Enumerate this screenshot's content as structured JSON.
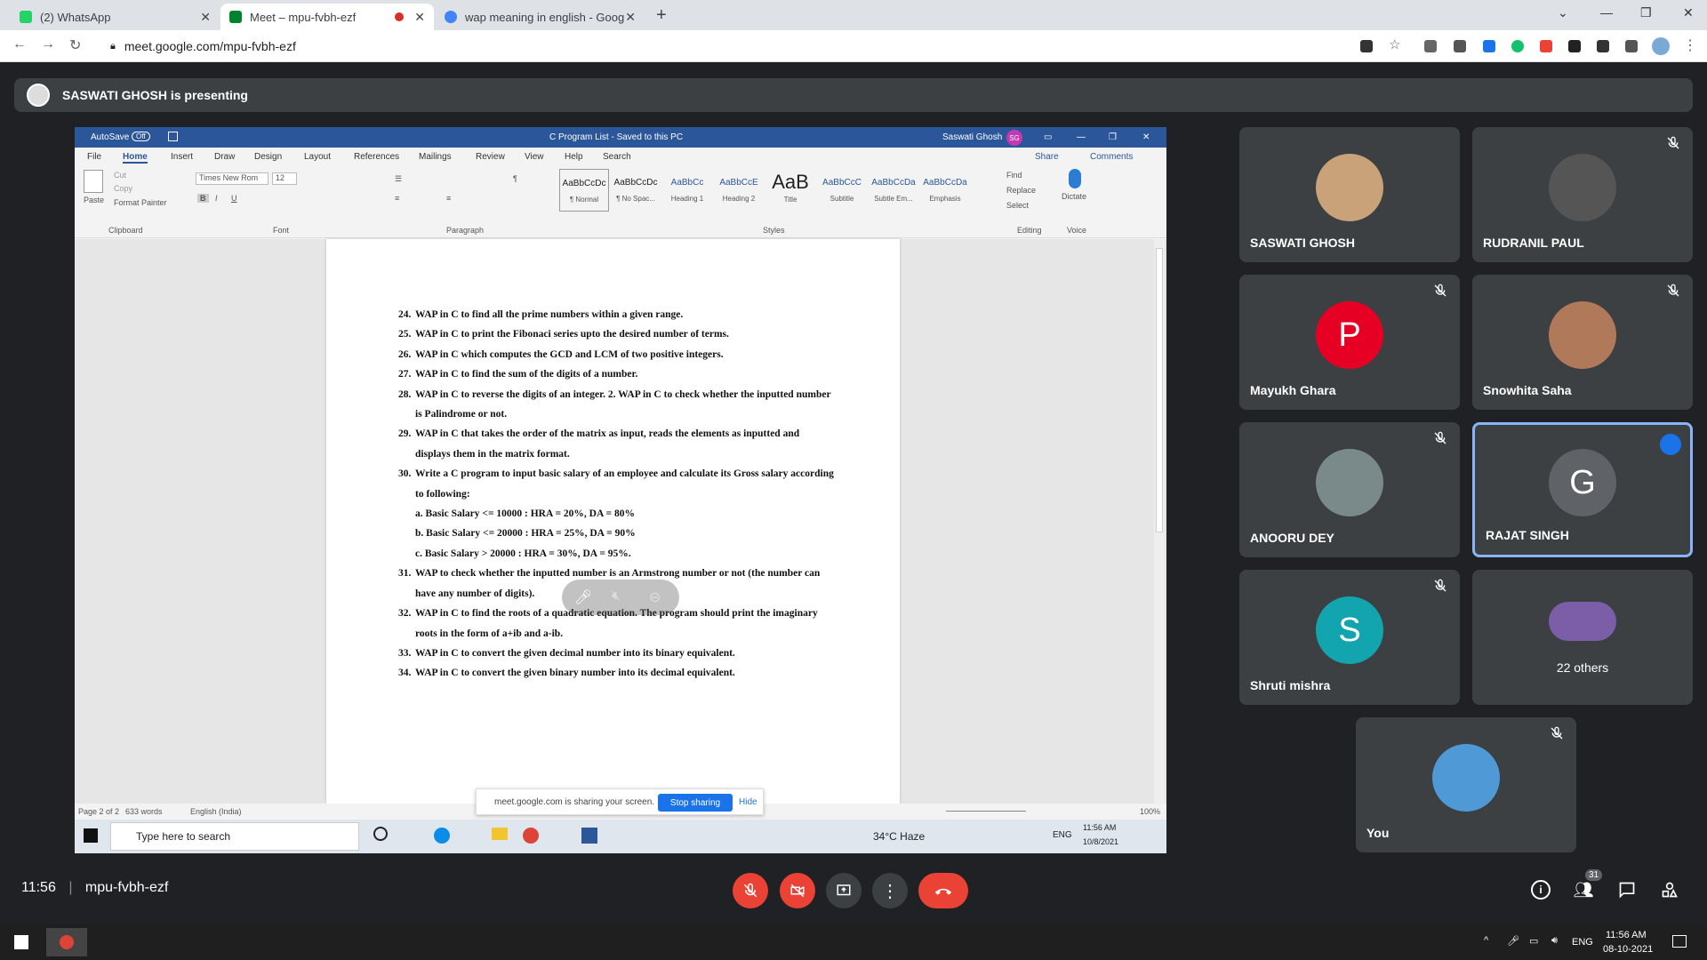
{
  "browser": {
    "tabs": [
      {
        "label": "(2) WhatsApp",
        "color": "#25d366"
      },
      {
        "label": "Meet – mpu-fvbh-ezf",
        "color": "#00832d"
      },
      {
        "label": "wap meaning in english - Google",
        "color": "#4285f4"
      }
    ],
    "url": "meet.google.com/mpu-fvbh-ezf"
  },
  "presenting": {
    "text": "SASWATI GHOSH is presenting"
  },
  "word": {
    "autosave": "AutoSave",
    "autosave_state": "Off",
    "doc_title": "C Program List - Saved to this PC",
    "user": "Saswati Ghosh",
    "user_initials": "SG",
    "menu": [
      "File",
      "Home",
      "Insert",
      "Draw",
      "Design",
      "Layout",
      "References",
      "Mailings",
      "Review",
      "View",
      "Help",
      "Search"
    ],
    "share": "Share",
    "comments": "Comments",
    "font_name": "Times New Rom",
    "font_size": "12",
    "groups": [
      "Clipboard",
      "Font",
      "Paragraph",
      "Styles",
      "Editing",
      "Voice"
    ],
    "clipboard": [
      "Paste",
      "Cut",
      "Copy",
      "Format Painter"
    ],
    "styles": [
      {
        "sample": "AaBbCcDc",
        "name": "¶ Normal"
      },
      {
        "sample": "AaBbCcDc",
        "name": "¶ No Spac..."
      },
      {
        "sample": "AaBbCc",
        "name": "Heading 1"
      },
      {
        "sample": "AaBbCcE",
        "name": "Heading 2"
      },
      {
        "sample": "AaB",
        "name": "Title"
      },
      {
        "sample": "AaBbCcC",
        "name": "Subtitle"
      },
      {
        "sample": "AaBbCcDa",
        "name": "Subtle Em..."
      },
      {
        "sample": "AaBbCcDa",
        "name": "Emphasis"
      }
    ],
    "editing": [
      "Find",
      "Replace",
      "Select"
    ],
    "dictate": "Dictate",
    "items": [
      {
        "n": "24.",
        "text": "WAP in C to find all the prime numbers within a given range."
      },
      {
        "n": "25.",
        "text": "WAP in C to print the Fibonaci series upto the desired number of terms."
      },
      {
        "n": "26.",
        "text": "WAP in C which computes the GCD and LCM of two positive integers."
      },
      {
        "n": "27.",
        "text": "WAP in C to find the sum of the digits of a number."
      },
      {
        "n": "28.",
        "text": "WAP in C to reverse the digits of an integer. 2. WAP in C to check whether the inputted number is Palindrome or not."
      },
      {
        "n": "29.",
        "text": "WAP in C that takes the order of the matrix as input, reads the elements as inputted and displays them in the matrix format."
      },
      {
        "n": "30.",
        "text": "Write a C program to input basic salary of an employee and calculate its Gross salary according to following:"
      }
    ],
    "subitems": [
      "a. Basic Salary <= 10000 : HRA = 20%, DA = 80%",
      "b. Basic Salary <= 20000 : HRA = 25%, DA = 90%",
      "c. Basic Salary > 20000 : HRA = 30%, DA = 95%."
    ],
    "items2": [
      {
        "n": "31.",
        "text": "WAP to check whether the inputted number is an Armstrong number or not (the number can have any number of digits)."
      },
      {
        "n": "32.",
        "text": "WAP in C to find the roots of a quadratic equation. The program should print the imaginary roots in the form of a+ib and a-ib."
      },
      {
        "n": "33.",
        "text": "WAP in C to convert the given decimal number into its binary equivalent."
      },
      {
        "n": "34.",
        "text": "WAP in C to convert the given binary number into its decimal equivalent."
      }
    ],
    "status_page": "Page 2 of 2",
    "status_words": "633 words",
    "status_lang": "English (India)",
    "zoom": "100%",
    "share_bar": {
      "text": "meet.google.com is sharing your screen.",
      "stop": "Stop sharing",
      "hide": "Hide"
    },
    "taskbar": {
      "search": "Type here to search",
      "weather": "34°C Haze",
      "lang": "ENG",
      "time": "11:56 AM",
      "date": "10/8/2021"
    }
  },
  "participants": [
    {
      "name": "SASWATI GHOSH",
      "initial": "",
      "color": "#c9a27a",
      "muted": false
    },
    {
      "name": "RUDRANIL PAUL",
      "initial": "",
      "color": "#555555",
      "muted": true
    },
    {
      "name": "Mayukh Ghara",
      "initial": "P",
      "color": "#e60023",
      "muted": true
    },
    {
      "name": "Snowhita Saha",
      "initial": "",
      "color": "#b07a5a",
      "muted": true
    },
    {
      "name": "ANOORU DEY",
      "initial": "",
      "color": "#7a8a8a",
      "muted": true
    },
    {
      "name": "RAJAT SINGH",
      "initial": "G",
      "color": "#5f6368",
      "muted": false
    },
    {
      "name": "Shruti mishra",
      "initial": "S",
      "color": "#12a4af",
      "muted": true
    },
    {
      "name": "22 others",
      "initial": "",
      "color": "#7b5ea7",
      "muted": false
    },
    {
      "name": "You",
      "initial": "",
      "color": "#4f9ad6",
      "muted": true
    }
  ],
  "meet_bar": {
    "time": "11:56",
    "code": "mpu-fvbh-ezf",
    "people_count": "31"
  },
  "os": {
    "time": "11:56 AM",
    "date": "08-10-2021",
    "lang": "ENG"
  }
}
